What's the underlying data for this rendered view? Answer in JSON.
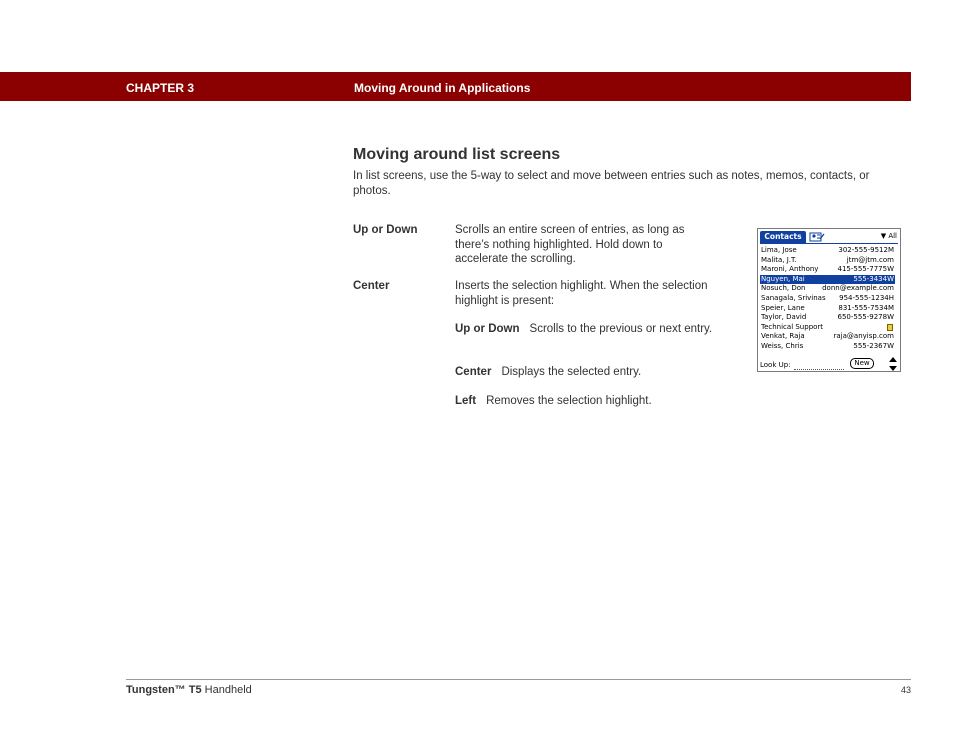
{
  "header": {
    "chapter": "CHAPTER 3",
    "title": "Moving Around in Applications"
  },
  "section": {
    "title": "Moving around list screens",
    "intro": "In list screens, use the 5-way to select and move between entries such as notes, memos, contacts, or photos."
  },
  "terms": [
    {
      "term": "Up or Down",
      "desc": "Scrolls an entire screen of entries, as long as there’s nothing highlighted. Hold down to accelerate the scrolling."
    },
    {
      "term": "Center",
      "desc": "Inserts the selection highlight. When the selection highlight is present:"
    }
  ],
  "subitems": [
    {
      "term": "Up or Down",
      "desc": "Scrolls to the previous or next entry."
    },
    {
      "term": "Center",
      "desc": "Displays the selected entry."
    },
    {
      "term": "Left",
      "desc": "Removes the selection highlight."
    }
  ],
  "palm": {
    "tab": "Contacts",
    "category": "All",
    "contacts": [
      {
        "name": "Lima, Jose",
        "phone": "302-555-9512M"
      },
      {
        "name": "Malita, J.T.",
        "phone": "jtm@jtm.com"
      },
      {
        "name": "Maroni, Anthony",
        "phone": "415-555-7775W"
      },
      {
        "name": "Nguyen, Mai",
        "phone": "555-3434W",
        "selected": true
      },
      {
        "name": "Nosuch, Don",
        "phone": "donn@example.com"
      },
      {
        "name": "Sanagala, Srivinas",
        "phone": "954-555-1234H"
      },
      {
        "name": "Speier, Lane",
        "phone": "831-555-7534M"
      },
      {
        "name": "Taylor, David",
        "phone": "650-555-9278W"
      },
      {
        "name": "Technical Support",
        "phone": "",
        "note": true
      },
      {
        "name": "Venkat, Raja",
        "phone": "raja@anyisp.com"
      },
      {
        "name": "Weiss, Chris",
        "phone": "555-2367W"
      }
    ],
    "lookup_label": "Look Up:",
    "new_label": "New"
  },
  "footer": {
    "product": "Tungsten™",
    "model": "T5",
    "suffix": "Handheld",
    "page": "43"
  }
}
